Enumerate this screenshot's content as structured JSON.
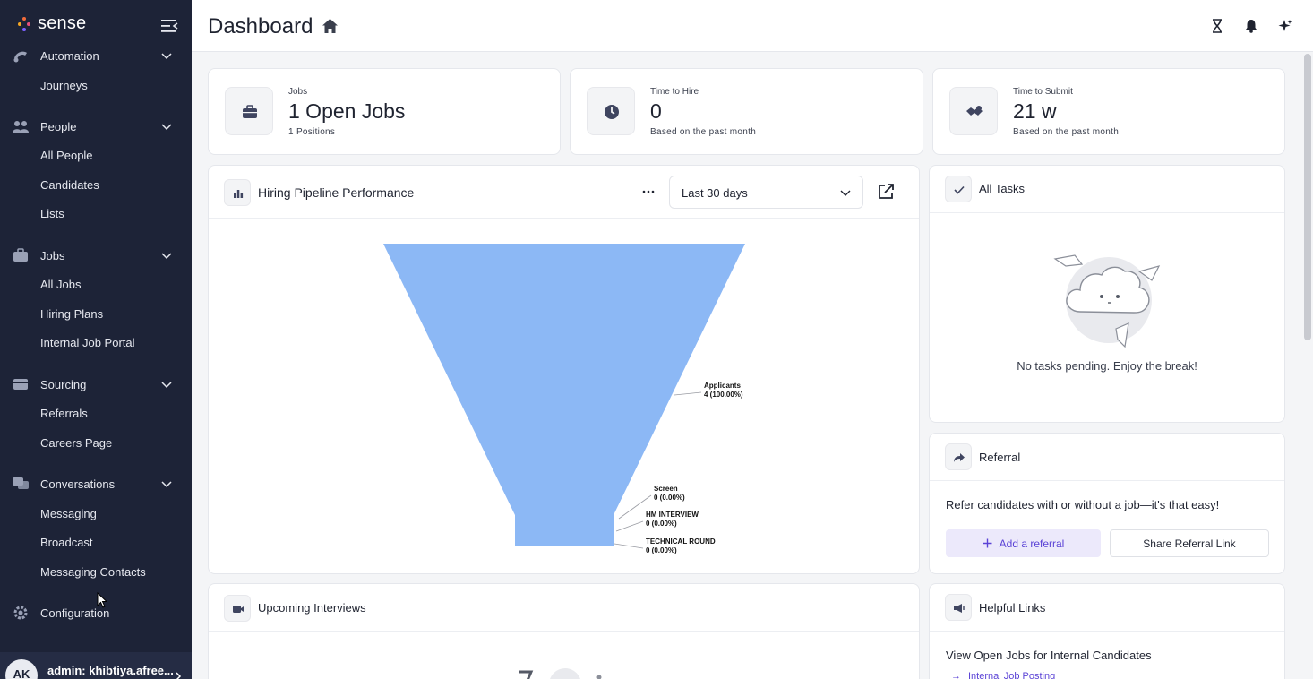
{
  "sidebar": {
    "brand": "sense",
    "groups": [
      {
        "label": "Automation",
        "items": [
          "Journeys"
        ]
      },
      {
        "label": "People",
        "items": [
          "All People",
          "Candidates",
          "Lists"
        ]
      },
      {
        "label": "Jobs",
        "items": [
          "All Jobs",
          "Hiring Plans",
          "Internal Job Portal"
        ]
      },
      {
        "label": "Sourcing",
        "items": [
          "Referrals",
          "Careers Page"
        ]
      },
      {
        "label": "Conversations",
        "items": [
          "Messaging",
          "Broadcast",
          "Messaging Contacts"
        ]
      }
    ],
    "configuration": "Configuration",
    "user": {
      "initials": "AK",
      "label": "admin: khibtiya.afree..."
    }
  },
  "header": {
    "title": "Dashboard"
  },
  "stats": [
    {
      "label": "Jobs",
      "value": "1 Open Jobs",
      "sub": "1 Positions",
      "icon": "briefcase-icon"
    },
    {
      "label": "Time to Hire",
      "value": "0",
      "sub": "Based on the past month",
      "icon": "clock-icon"
    },
    {
      "label": "Time to Submit",
      "value": "21 w",
      "sub": "Based on the past month",
      "icon": "handshake-icon"
    }
  ],
  "pipeline": {
    "title": "Hiring Pipeline Performance",
    "range": "Last 30 days"
  },
  "chart_data": {
    "type": "funnel",
    "stages": [
      {
        "name": "Applicants",
        "value": 4,
        "label": "4 (100.00%)"
      },
      {
        "name": "Screen",
        "value": 0,
        "label": "0 (0.00%)"
      },
      {
        "name": "HM INTERVIEW",
        "value": 0,
        "label": "0 (0.00%)"
      },
      {
        "name": "TECHNICAL ROUND",
        "value": 0,
        "label": "0 (0.00%)"
      }
    ],
    "color": "#8cb8f5"
  },
  "tasks": {
    "title": "All Tasks",
    "empty": "No tasks pending. Enjoy the break!"
  },
  "referral": {
    "title": "Referral",
    "text": "Refer candidates with or without a job—it's that easy!",
    "add_label": "Add a referral",
    "share_label": "Share Referral Link"
  },
  "interviews": {
    "title": "Upcoming Interviews"
  },
  "links": {
    "title": "Helpful Links",
    "section": "View Open Jobs for Internal Candidates",
    "item": "Internal Job Posting"
  },
  "colors": {
    "sidebar": "#1d2337",
    "accent": "#5b43d6",
    "funnel": "#8cb8f5"
  }
}
